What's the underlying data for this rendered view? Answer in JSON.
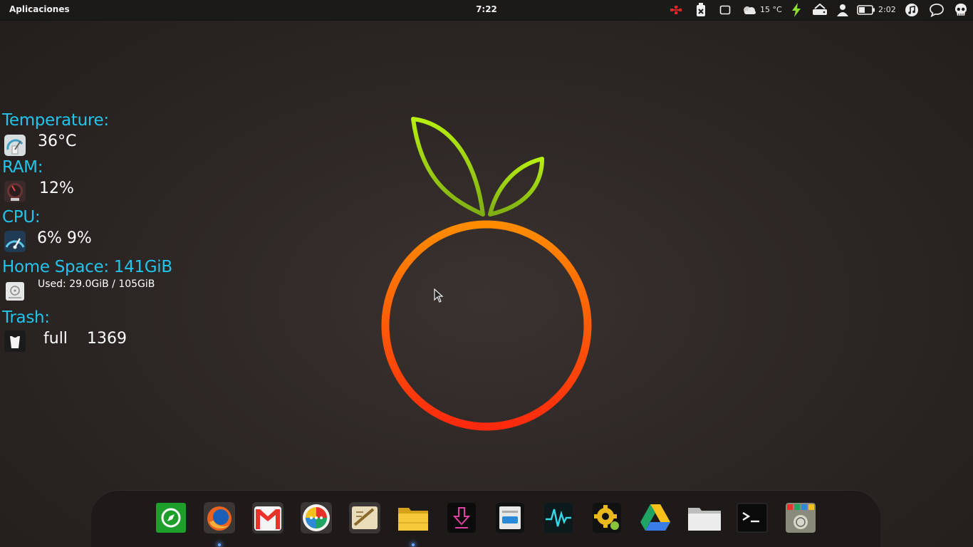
{
  "panel": {
    "apps_menu": "Aplicaciones",
    "clock": "7:22",
    "weather_temp": "15 °C",
    "battery_time": "2:02",
    "tray_icons": [
      "network-icon",
      "usb-icon",
      "window-icon",
      "weather-icon",
      "power-icon",
      "drive-icon",
      "user-icon",
      "battery-icon",
      "music-icon",
      "chat-icon",
      "skull-icon"
    ]
  },
  "conky": {
    "temperature_label": "Temperature:",
    "temperature_value": "36°C",
    "ram_label": "RAM:",
    "ram_value": "12%",
    "cpu_label": "CPU:",
    "cpu_value": "6% 9%",
    "home_label": "Home Space: 141GiB",
    "home_used": "Used: 29.0GiB / 105GiB",
    "trash_label": "Trash:",
    "trash_status": "full",
    "trash_count": "1369"
  },
  "dock": {
    "items": [
      {
        "name": "compass-app-icon",
        "color": "#1e9e2a"
      },
      {
        "name": "firefox-icon",
        "color": "#e9631f"
      },
      {
        "name": "gmail-icon",
        "color": "#e8332a"
      },
      {
        "name": "chat-bubbles-icon",
        "color": "#f2c21a"
      },
      {
        "name": "text-editor-icon",
        "color": "#c8a05a"
      },
      {
        "name": "folder-yellow-icon",
        "color": "#f6c93a"
      },
      {
        "name": "download-icon",
        "color": "#e040a0"
      },
      {
        "name": "toggle-app-icon",
        "color": "#2a8ad8"
      },
      {
        "name": "system-monitor-icon",
        "color": "#37d6e8"
      },
      {
        "name": "settings-gear-icon",
        "color": "#e8b81c"
      },
      {
        "name": "google-drive-icon",
        "color": "#1fa463"
      },
      {
        "name": "files-folder-icon",
        "color": "#e8e8e8"
      },
      {
        "name": "terminal-icon",
        "color": "#111111"
      },
      {
        "name": "app-store-icon",
        "color": "#8a8a7a"
      }
    ]
  }
}
